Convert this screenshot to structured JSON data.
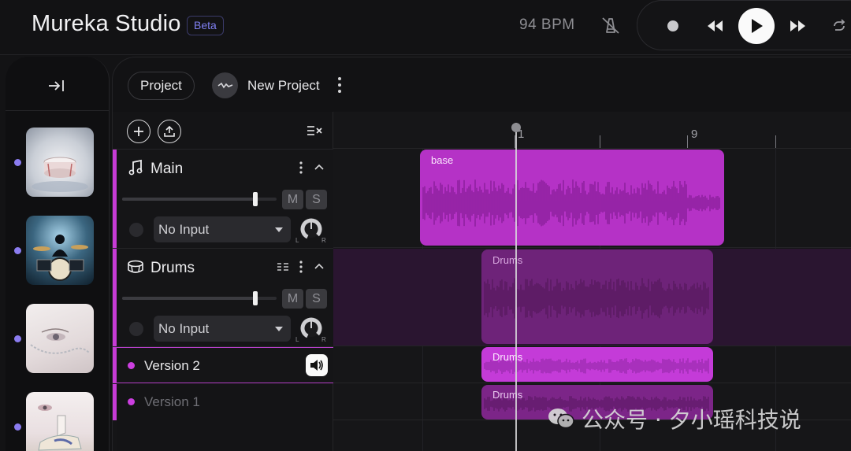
{
  "header": {
    "app_title": "Mureka Studio",
    "badge": "Beta",
    "bpm": "94 BPM"
  },
  "project_bar": {
    "project_button": "Project",
    "project_name": "New Project"
  },
  "tracks": [
    {
      "name": "Main",
      "icon": "music-note-icon",
      "mute": "M",
      "solo": "S",
      "input": "No Input",
      "volume": 0.86,
      "pan_left": "L",
      "pan_right": "R"
    },
    {
      "name": "Drums",
      "icon": "drum-icon",
      "mute": "M",
      "solo": "S",
      "input": "No Input",
      "volume": 0.86,
      "pan_left": "L",
      "pan_right": "R"
    }
  ],
  "versions": [
    {
      "name": "Version 2",
      "active": true
    },
    {
      "name": "Version 1",
      "active": false
    }
  ],
  "timeline": {
    "ruler_labels": [
      "1",
      "9"
    ],
    "clips": [
      {
        "label": "base",
        "lane": "main"
      },
      {
        "label": "Drums",
        "lane": "drums"
      },
      {
        "label": "Drums",
        "lane": "version-2"
      },
      {
        "label": "Drums",
        "lane": "version-1"
      }
    ]
  },
  "watermark": "公众号 · 夕小瑶科技说",
  "colors": {
    "accent": "#c73bd6",
    "clip_bright": "#b532c6",
    "clip_dim": "#6e2379",
    "background": "#131315"
  }
}
